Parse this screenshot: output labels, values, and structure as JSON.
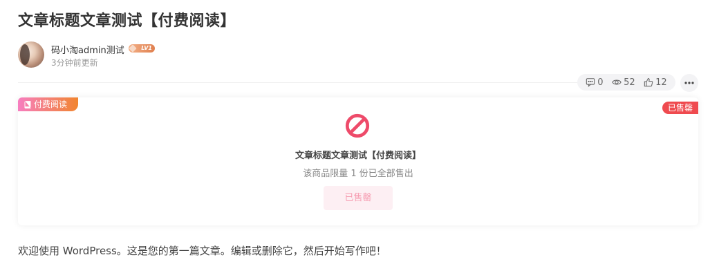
{
  "post": {
    "title": "文章标题文章测试【付费阅读】",
    "author_name": "码小淘admin测试",
    "author_level": "LV1",
    "updated": "3分钟前更新",
    "content": "欢迎使用 WordPress。这是您的第一篇文章。编辑或删除它，然后开始写作吧！"
  },
  "stats": {
    "comments": "0",
    "views": "52",
    "likes": "12"
  },
  "card": {
    "paid_tag": "付费阅读",
    "sold_tag": "已售罄",
    "title": "文章标题文章测试【付费阅读】",
    "note": "该商品限量 1 份已全部售出",
    "button": "已售罄"
  },
  "icons": {
    "comment": "comment-icon",
    "views": "eye-icon",
    "likes": "thumbs-up-icon",
    "more": "more-icon",
    "paid": "book-icon",
    "status": "ban-icon"
  },
  "colors": {
    "sold_red": "#ef4a4f",
    "ban_icon": "#ee4b6a",
    "sold_button_bg": "#fdeff3",
    "sold_button_text": "#f69cb1",
    "paid_gradient_start": "#f77ec0",
    "paid_gradient_end": "#f1852f"
  }
}
